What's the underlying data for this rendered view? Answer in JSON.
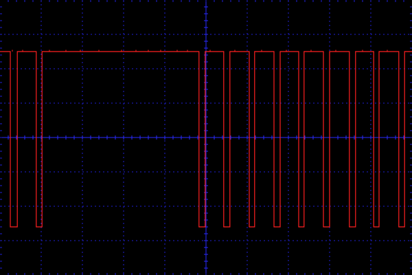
{
  "chart_data": {
    "type": "line",
    "title": "",
    "xlabel": "",
    "ylabel": "",
    "grid": true,
    "divisions": {
      "x": 10,
      "y": 8
    },
    "xlim": [
      0,
      10
    ],
    "ylim": [
      -4,
      4
    ],
    "colors": {
      "background": "#000000",
      "grid": "#1f1fd6",
      "center_axes": "#2a2aff",
      "trace": "#ff2020"
    },
    "series": [
      {
        "levels": {
          "high": 2.5,
          "low": -2.6
        },
        "low_pulses": [
          [
            0.25,
            0.42
          ],
          [
            0.88,
            1.02
          ],
          [
            4.83,
            4.98
          ],
          [
            5.43,
            5.58
          ],
          [
            6.05,
            6.18
          ],
          [
            6.65,
            6.8
          ],
          [
            7.25,
            7.38
          ],
          [
            7.85,
            8.0
          ],
          [
            8.48,
            8.63
          ],
          [
            9.07,
            9.2
          ],
          [
            9.68,
            9.82
          ]
        ]
      }
    ]
  }
}
